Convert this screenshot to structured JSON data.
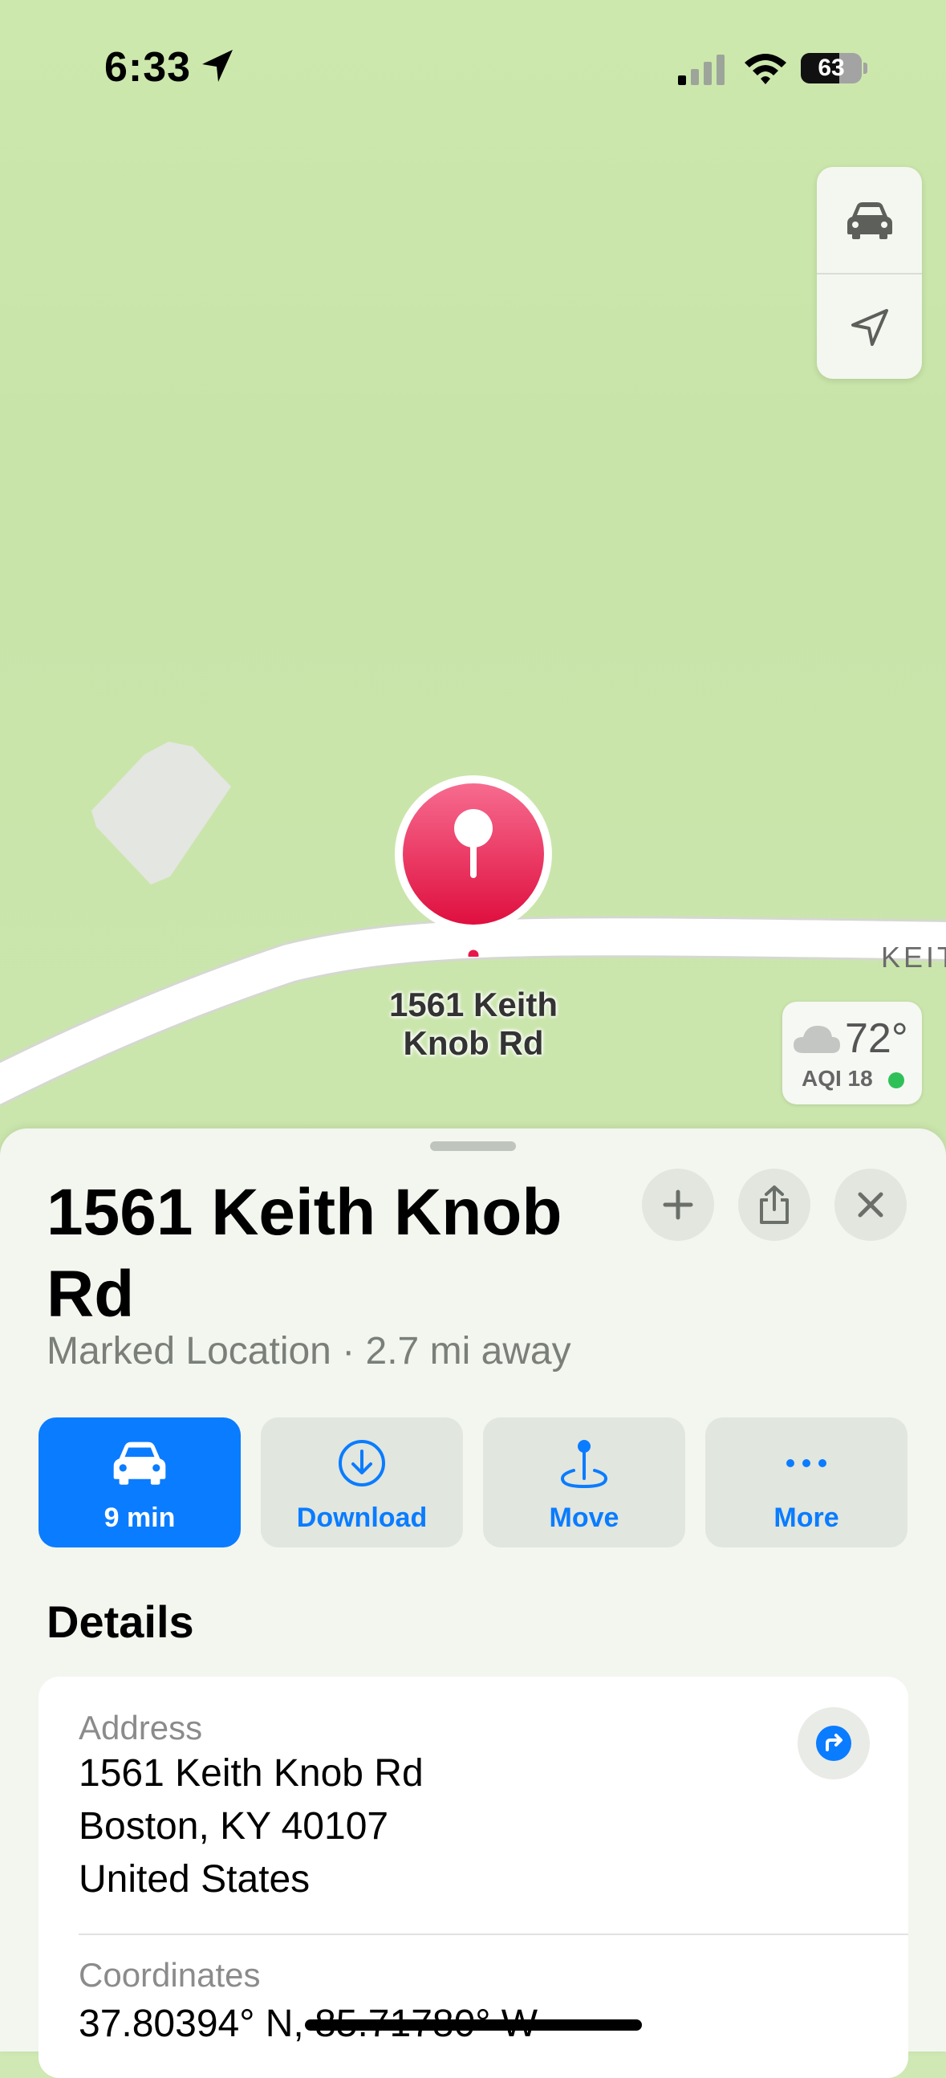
{
  "status_bar": {
    "time": "6:33",
    "battery": "63",
    "battery_level": 0.63
  },
  "map": {
    "pin_label_line1": "1561 Keith",
    "pin_label_line2": "Knob Rd",
    "road_label": "KEIT",
    "weather_temp": "72°",
    "weather_aqi": "AQI 18",
    "controls": {
      "drive_icon": "car-icon",
      "location_icon": "location-arrow-icon"
    }
  },
  "sheet": {
    "title": "1561 Keith Knob Rd",
    "subtitle": "Marked Location · 2.7 mi away",
    "actions": [
      {
        "label": "9 min",
        "icon": "car-icon"
      },
      {
        "label": "Download",
        "icon": "download-icon"
      },
      {
        "label": "Move",
        "icon": "move-pin-icon"
      },
      {
        "label": "More",
        "icon": "ellipsis-icon"
      }
    ],
    "details_heading": "Details",
    "address_label": "Address",
    "address_line1": "1561 Keith Knob Rd",
    "address_line2": "Boston, KY  40107",
    "address_line3": "United States",
    "coordinates_label": "Coordinates",
    "coordinates_value": "37.80394° N, 85.71780° W"
  },
  "colors": {
    "accent": "#0a7cff",
    "pin": "#e8174a",
    "map_green": "#cbe6ad"
  }
}
